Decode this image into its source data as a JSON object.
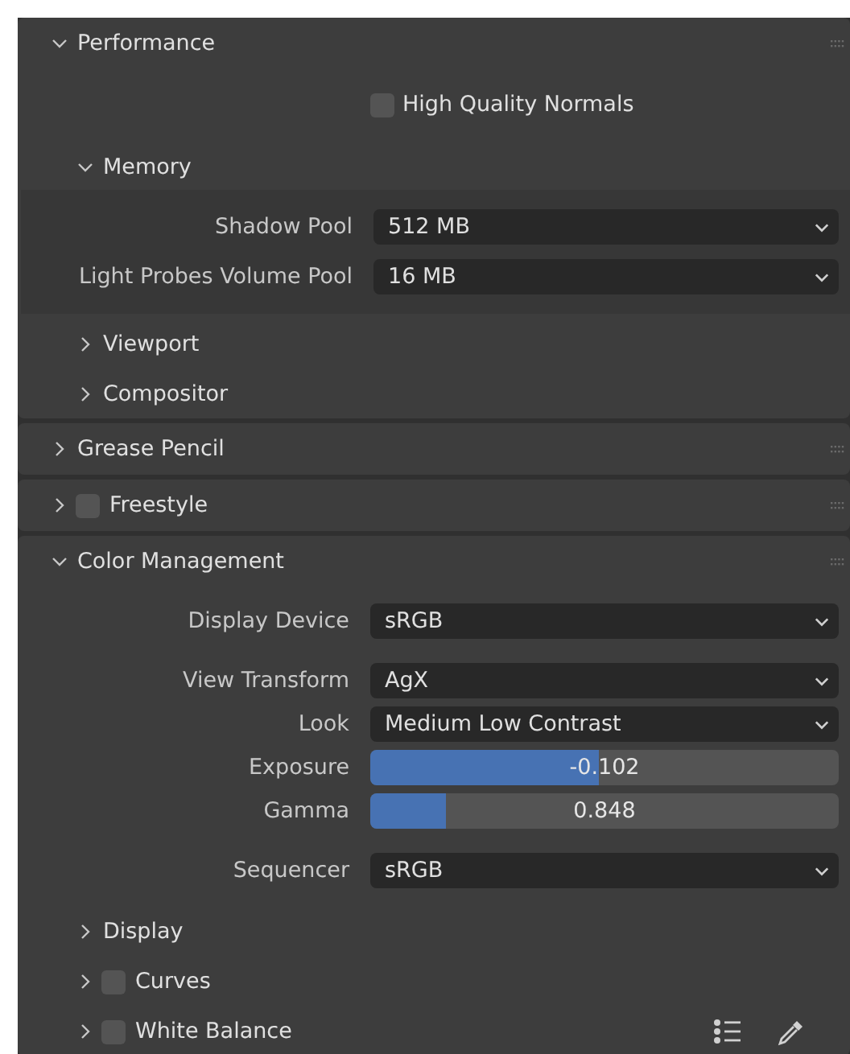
{
  "panels": [
    {
      "title": "Performance",
      "expanded": true,
      "items": [
        {
          "kind": "checkbox",
          "label": "High Quality Normals",
          "checked": false
        },
        {
          "kind": "subpanel",
          "title": "Memory",
          "expanded": true,
          "groups": [
            [
              {
                "kind": "dropdown",
                "label": "Shadow Pool",
                "value": "512 MB"
              },
              {
                "kind": "dropdown",
                "label": "Light Probes Volume Pool",
                "value": "16 MB"
              }
            ]
          ]
        },
        {
          "kind": "subpanel",
          "title": "Viewport",
          "expanded": false
        },
        {
          "kind": "subpanel",
          "title": "Compositor",
          "expanded": false
        }
      ]
    },
    {
      "title": "Grease Pencil",
      "expanded": false
    },
    {
      "title": "Freestyle",
      "expanded": false,
      "checked": false
    },
    {
      "title": "Color Management",
      "expanded": true,
      "items": [
        {
          "kind": "group",
          "rows": [
            {
              "kind": "dropdown",
              "label": "Display Device",
              "value": "sRGB"
            }
          ]
        },
        {
          "kind": "group",
          "rows": [
            {
              "kind": "dropdown",
              "label": "View Transform",
              "value": "AgX"
            },
            {
              "kind": "dropdown",
              "label": "Look",
              "value": "Medium Low Contrast"
            },
            {
              "kind": "slider",
              "label": "Exposure",
              "value": "-0.102",
              "level": 0.488
            },
            {
              "kind": "slider",
              "label": "Gamma",
              "value": "0.848",
              "level": 0.16
            }
          ]
        },
        {
          "kind": "group",
          "rows": [
            {
              "kind": "dropdown",
              "label": "Sequencer",
              "value": "sRGB"
            }
          ]
        },
        {
          "kind": "subpanel",
          "title": "Display",
          "expanded": false
        },
        {
          "kind": "subpanel",
          "title": "Curves",
          "expanded": false,
          "checked": false
        },
        {
          "kind": "subpanel",
          "title": "White Balance",
          "expanded": false,
          "checked": false,
          "preset_tools": true
        }
      ]
    }
  ]
}
